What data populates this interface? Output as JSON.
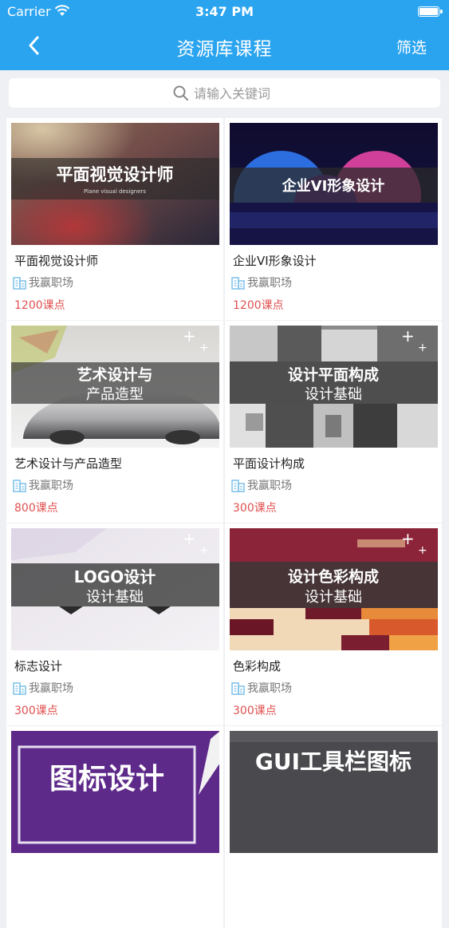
{
  "status_bar": {
    "carrier": "Carrier",
    "time": "3:47 PM"
  },
  "nav": {
    "title": "资源库课程",
    "filter_label": "筛选"
  },
  "search": {
    "placeholder": "请输入关键词"
  },
  "colors": {
    "header": "#2ba4f0",
    "price": "#e05050",
    "background": "#eef0f3"
  },
  "courses": [
    {
      "name": "平面视觉设计师",
      "provider": "我赢职场",
      "price": "1200课点",
      "banner": {
        "line1": "平面视觉设计师",
        "line2": "Plane visual designers"
      }
    },
    {
      "name": "企业VI形象设计",
      "provider": "我赢职场",
      "price": "1200课点",
      "banner": {
        "line1": "企业VI形象设计",
        "line2": ""
      }
    },
    {
      "name": "艺术设计与产品造型",
      "provider": "我赢职场",
      "price": "800课点",
      "banner": {
        "line1": "艺术设计与",
        "line2": "产品造型"
      }
    },
    {
      "name": "平面设计构成",
      "provider": "我赢职场",
      "price": "300课点",
      "banner": {
        "line1": "设计平面构成",
        "line2": "设计基础"
      }
    },
    {
      "name": "标志设计",
      "provider": "我赢职场",
      "price": "300课点",
      "banner": {
        "line1": "LOGO设计",
        "line2": "设计基础"
      }
    },
    {
      "name": "色彩构成",
      "provider": "我赢职场",
      "price": "300课点",
      "banner": {
        "line1": "设计色彩构成",
        "line2": "设计基础"
      }
    },
    {
      "name": "",
      "provider": "",
      "price": "",
      "banner": {
        "line1": "图标设计",
        "line2": ""
      }
    },
    {
      "name": "",
      "provider": "",
      "price": "",
      "banner": {
        "line1": "GUI工具栏图标",
        "line2": ""
      }
    }
  ]
}
